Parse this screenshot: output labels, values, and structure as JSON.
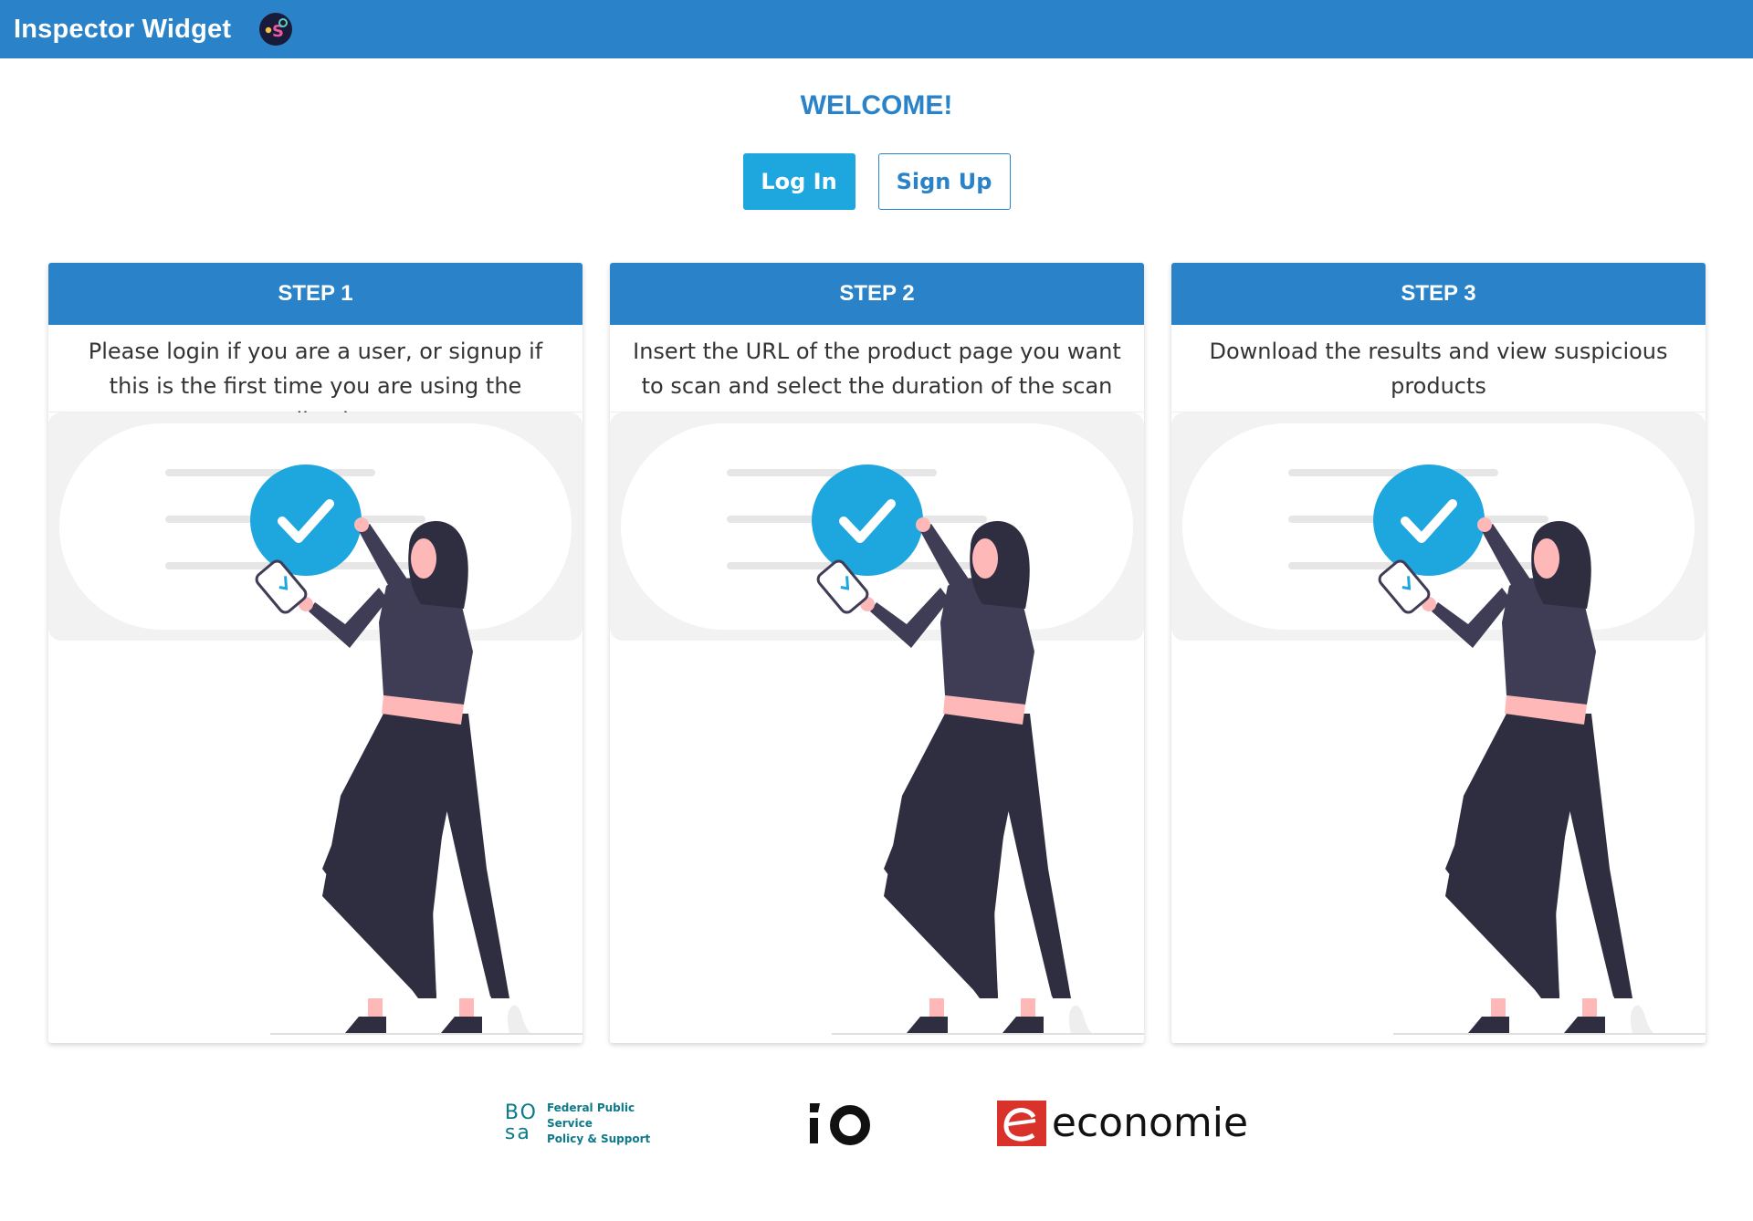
{
  "header": {
    "title": "Inspector Widget",
    "logo_icon": "app-logo-icon"
  },
  "welcome": "WELCOME!",
  "auth": {
    "login_label": "Log In",
    "signup_label": "Sign Up"
  },
  "steps": [
    {
      "title": "STEP 1",
      "description": "Please login if you are a user, or signup if this is the first time you are using the application"
    },
    {
      "title": "STEP 2",
      "description": "Insert the URL of the product page you want to scan and select the duration of the scan"
    },
    {
      "title": "STEP 3",
      "description": "Download the results and view suspicious products"
    }
  ],
  "footer": {
    "bosa_mark_top": "BO",
    "bosa_mark_bottom": "sa",
    "bosa_line1": "Federal Public Service",
    "bosa_line2": "Policy & Support",
    "io_icon": "io-logo-icon",
    "economie_text": "economie"
  },
  "colors": {
    "brand": "#2a83c8",
    "accent": "#1ea7df",
    "check": "#1ea7df",
    "shirt": "#3f3d56",
    "skin": "#ffb8b8"
  }
}
